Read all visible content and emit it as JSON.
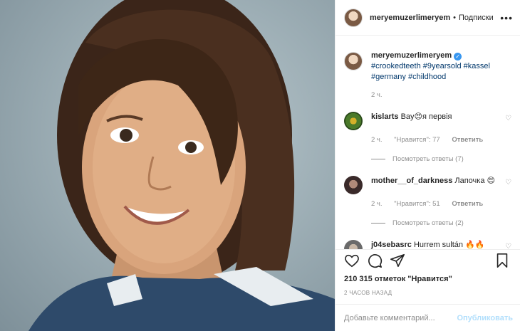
{
  "post": {
    "username": "meryemuzerlimeryem",
    "separator": "•",
    "follow_label": "Подписки",
    "more_label": "•••"
  },
  "caption": {
    "username": "meryemuzerlimeryem",
    "verified_mark": "✓",
    "hashtags": [
      "#crookedteeth",
      "#9yearsold",
      "#kassel",
      "#germany",
      "#childhood"
    ],
    "time": "2 ч."
  },
  "comments": [
    {
      "username": "kislarts",
      "text": "Bay😍я первія",
      "time": "2 ч.",
      "likes": "\"Нравится\": 77",
      "reply_label": "Ответить",
      "view_replies": "Посмотреть ответы (7)",
      "avatar_color": "#4a7a2a"
    },
    {
      "username": "mother__of_darkness",
      "text": "Лапочка 😍",
      "time": "2 ч.",
      "likes": "\"Нравится\": 51",
      "reply_label": "Ответить",
      "view_replies": "Посмотреть ответы (2)",
      "avatar_color": "#3a2a2a"
    },
    {
      "username": "j04sebasrc",
      "text": "Hurrem sultán 🔥🔥",
      "avatar_color": "#6a6a6a"
    }
  ],
  "actions": {
    "like_icon": "heart-icon",
    "comment_icon": "comment-icon",
    "share_icon": "share-icon",
    "save_icon": "bookmark-icon"
  },
  "likes_text": "210 315 отметок \"Нравится\"",
  "time_ago": "2 ЧАСОВ НАЗАД",
  "add_comment": {
    "placeholder": "Добавьте комментарий...",
    "publish_label": "Опубликовать"
  },
  "colors": {
    "link": "#00376b",
    "muted": "#8e8e8e",
    "verified": "#3897f0",
    "publish_disabled": "#b2dffc"
  }
}
